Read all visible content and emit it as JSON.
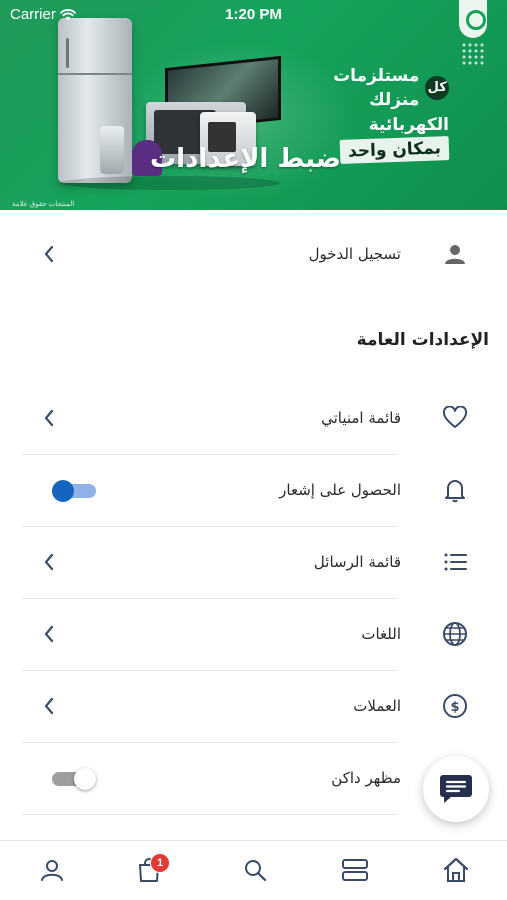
{
  "status_bar": {
    "carrier": "Carrier",
    "time": "1:20 PM"
  },
  "banner": {
    "promo_badge": "كل",
    "promo_line1": "مستلزمات منزلك",
    "promo_line2": "الكهربائية",
    "promo_line3": "بمكان واحد",
    "title": "ضبط الإعدادات",
    "watermark": "المنتجات حقوق علامة"
  },
  "login": {
    "label": "تسجيل الدخول",
    "icon": "person-icon"
  },
  "general_settings": {
    "title": "الإعدادات العامة",
    "items": [
      {
        "label": "قائمة امنياتي",
        "icon": "heart-icon",
        "control": "chevron"
      },
      {
        "label": "الحصول على إشعار",
        "icon": "bell-icon",
        "control": "toggle",
        "on": true
      },
      {
        "label": "قائمة الرسائل",
        "icon": "list-icon",
        "control": "chevron"
      },
      {
        "label": "اللغات",
        "icon": "globe-icon",
        "control": "chevron"
      },
      {
        "label": "العملات",
        "icon": "dollar-icon",
        "control": "chevron"
      },
      {
        "label": "مظهر داكن",
        "icon": "dark-mode",
        "control": "toggle",
        "on": false
      }
    ]
  },
  "tabbar": {
    "items": [
      "profile-icon",
      "cart-icon",
      "search-icon",
      "categories-icon",
      "home-icon"
    ],
    "cart_badge": "1"
  },
  "colors": {
    "banner_green": "#16a35c",
    "toggle_on": "#1565c0",
    "icon_slate": "#3b4a66",
    "badge_red": "#e53935"
  }
}
